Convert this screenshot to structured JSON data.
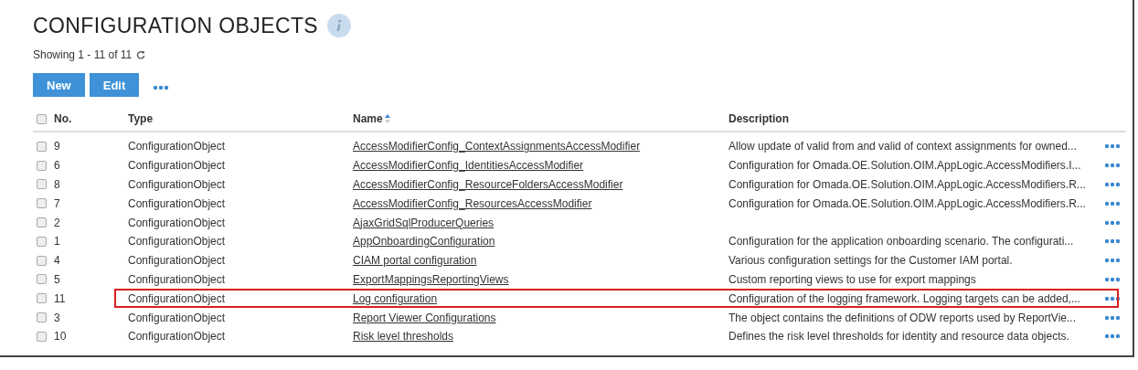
{
  "page": {
    "title": "CONFIGURATION OBJECTS",
    "showing": "Showing 1 - 11 of 11"
  },
  "toolbar": {
    "buttons": [
      "New",
      "Edit"
    ]
  },
  "table": {
    "select_all": {
      "checked": false
    },
    "columns": [
      {
        "label": "No.",
        "sorted": false
      },
      {
        "label": "Type",
        "sorted": false
      },
      {
        "label": "Name",
        "sorted": true
      },
      {
        "label": "Description",
        "sorted": false
      }
    ],
    "rows": [
      {
        "checked": false,
        "no": "9",
        "type": "ConfigurationObject",
        "name": "AccessModifierConfig_ContextAssignmentsAccessModifier",
        "description": "Allow update of valid from and valid of context assignments for owned...",
        "highlighted": false
      },
      {
        "checked": false,
        "no": "6",
        "type": "ConfigurationObject",
        "name": "AccessModifierConfig_IdentitiesAccessModifier",
        "description": "Configuration for Omada.OE.Solution.OIM.AppLogic.AccessModifiers.I...",
        "highlighted": false
      },
      {
        "checked": false,
        "no": "8",
        "type": "ConfigurationObject",
        "name": "AccessModifierConfig_ResourceFoldersAccessModifier",
        "description": "Configuration for Omada.OE.Solution.OIM.AppLogic.AccessModifiers.R...",
        "highlighted": false
      },
      {
        "checked": false,
        "no": "7",
        "type": "ConfigurationObject",
        "name": "AccessModifierConfig_ResourcesAccessModifier",
        "description": "Configuration for Omada.OE.Solution.OIM.AppLogic.AccessModifiers.R...",
        "highlighted": false
      },
      {
        "checked": false,
        "no": "2",
        "type": "ConfigurationObject",
        "name": "AjaxGridSqlProducerQueries",
        "highlighted": false
      },
      {
        "checked": false,
        "no": "1",
        "type": "ConfigurationObject",
        "name": "AppOnboardingConfiguration",
        "description": "Configuration for the application onboarding scenario. The configurati...",
        "highlighted": false
      },
      {
        "checked": false,
        "no": "4",
        "type": "ConfigurationObject",
        "name": "CIAM portal configuration",
        "description": "Various configuration settings for the Customer IAM portal.",
        "highlighted": false
      },
      {
        "checked": false,
        "no": "5",
        "type": "ConfigurationObject",
        "name": "ExportMappingsReportingViews",
        "description": "Custom reporting views to use for export mappings",
        "highlighted": false
      },
      {
        "checked": false,
        "no": "11",
        "type": "ConfigurationObject",
        "name": "Log configuration",
        "description": "Configuration of the logging framework. Logging targets can be added,...",
        "highlighted": true
      },
      {
        "checked": false,
        "no": "3",
        "type": "ConfigurationObject",
        "name": "Report Viewer Configurations",
        "description": "The object contains the definitions of ODW reports used by ReportVie...",
        "highlighted": false
      },
      {
        "checked": false,
        "no": "10",
        "type": "ConfigurationObject",
        "name": "Risk level thresholds",
        "description": "Defines the risk level thresholds for identity and resource data objects.",
        "highlighted": false
      }
    ]
  }
}
